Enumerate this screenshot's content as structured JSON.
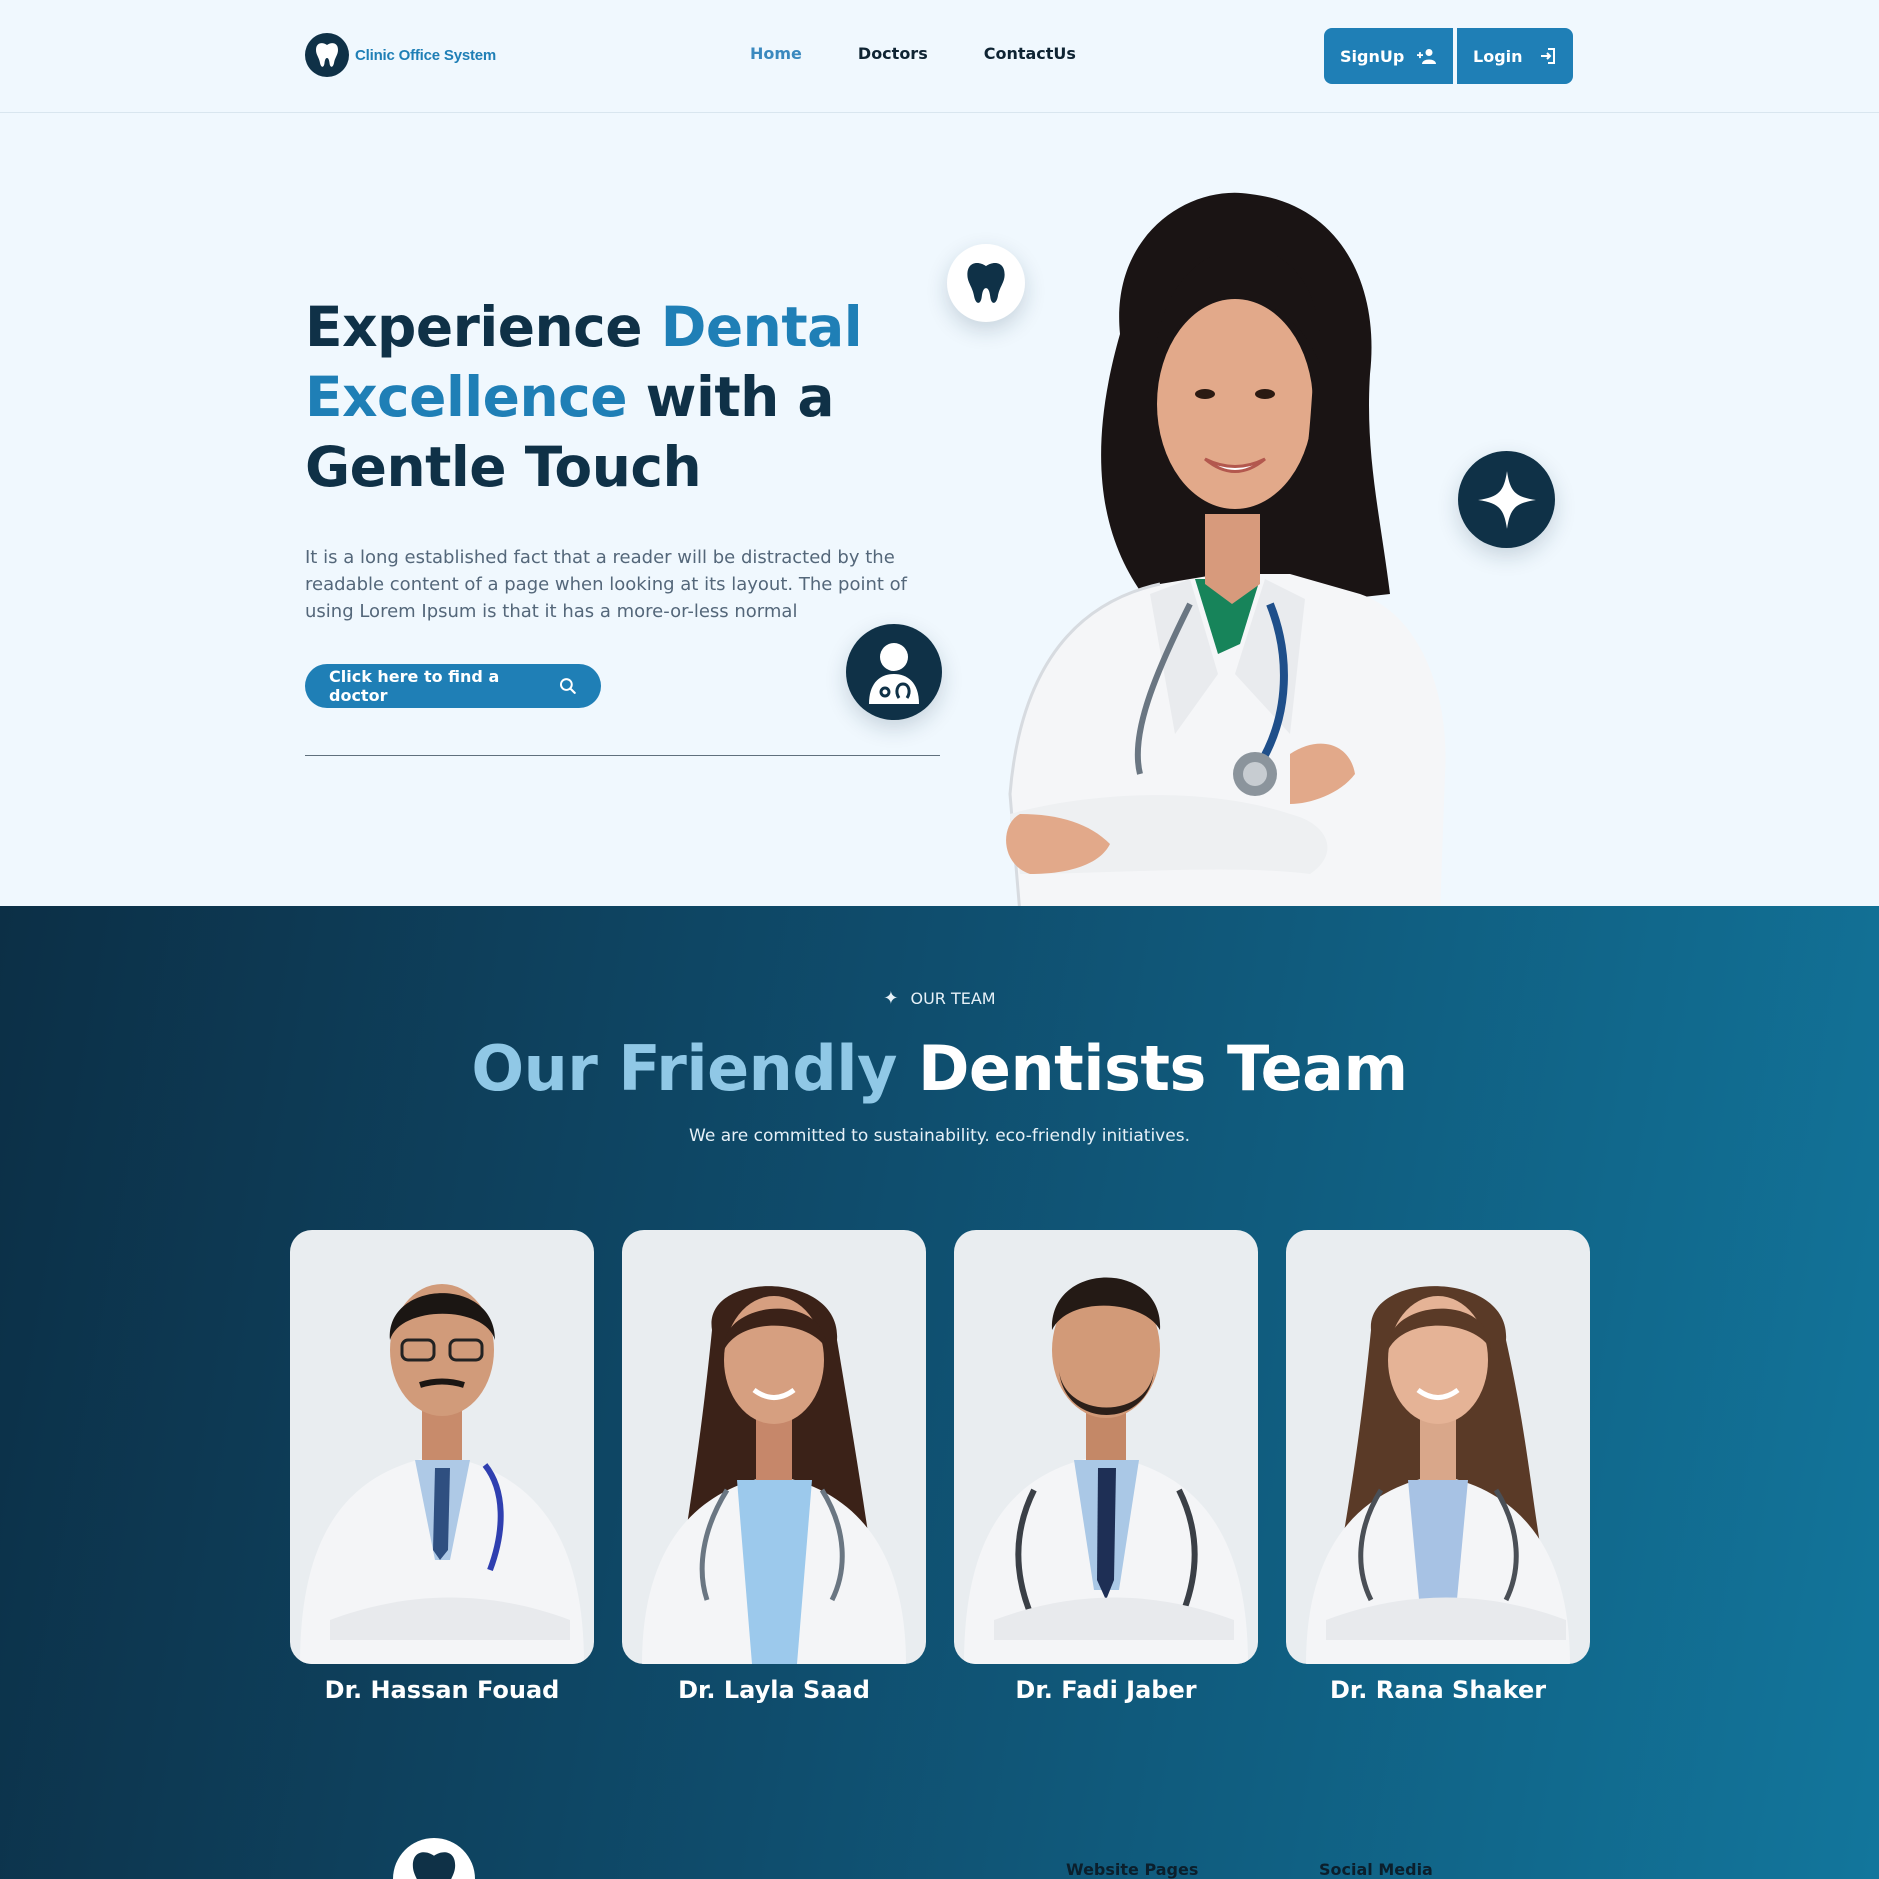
{
  "header": {
    "logo_text": "Clinic Office System",
    "nav": [
      {
        "label": "Home",
        "active": true
      },
      {
        "label": "Doctors",
        "active": false
      },
      {
        "label": "ContactUs",
        "active": false
      }
    ],
    "signup_label": "SignUp",
    "login_label": "Login"
  },
  "hero": {
    "title_part1": "Experience ",
    "title_accent": "Dental Excellence",
    "title_part2": " with a Gentle Touch",
    "description": "It is a long established fact that a reader will be distracted by the readable content of a page when looking at its layout. The point of using Lorem Ipsum is that it has a more-or-less normal",
    "cta_label": "Click here to find a doctor"
  },
  "team": {
    "eyebrow": "OUR TEAM",
    "title_light": "Our Friendly ",
    "title_white": "Dentists Team",
    "subtitle": "We are committed to sustainability. eco-friendly initiatives.",
    "doctors": [
      {
        "name": "Dr. Hassan Fouad"
      },
      {
        "name": "Dr. Layla Saad"
      },
      {
        "name": "Dr. Fadi Jaber"
      },
      {
        "name": "Dr. Rana Shaker"
      }
    ]
  },
  "footer": {
    "col1": "Website Pages",
    "col2": "Social Media"
  },
  "colors": {
    "primary": "#1f7fb6",
    "navy": "#0f3147",
    "background": "#f0f8fe",
    "team_gradient_start": "#0c2f46",
    "team_gradient_end": "#12769c"
  }
}
